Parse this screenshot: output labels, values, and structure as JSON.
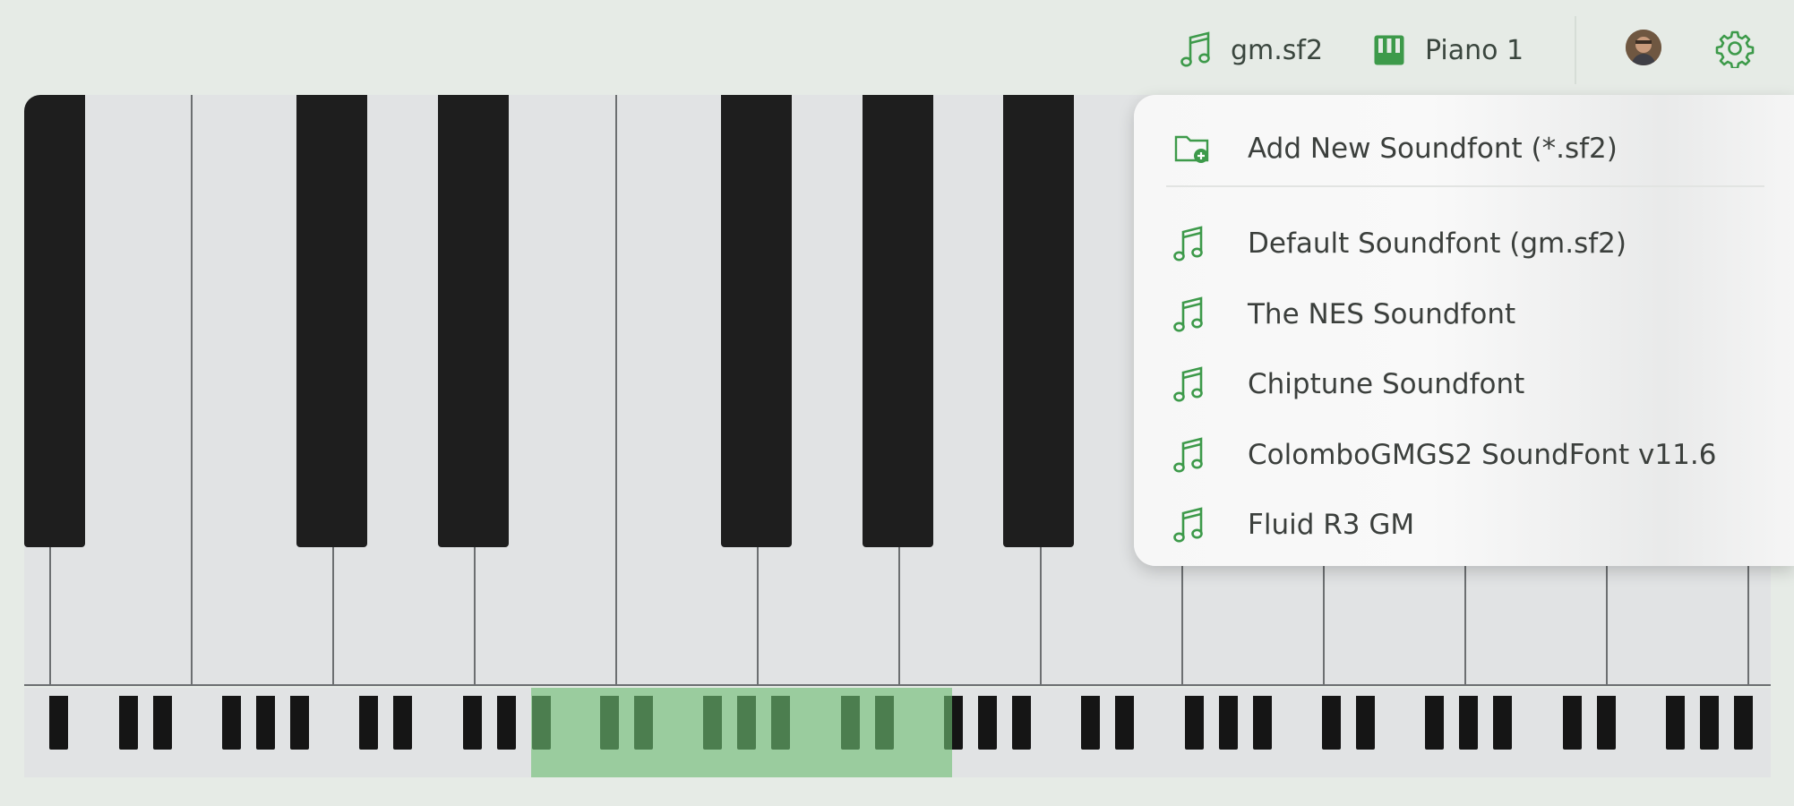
{
  "topbar": {
    "soundfont_label": "gm.sf2",
    "instrument_label": "Piano 1",
    "icons": {
      "soundfont": "music-note-icon",
      "instrument": "piano-keys-icon",
      "settings": "gear-icon"
    }
  },
  "dropdown": {
    "add_label": "Add New Soundfont (*.sf2)",
    "items": [
      "Default Soundfont (gm.sf2)",
      "The NES Soundfont",
      "Chiptune Soundfont",
      "ColomboGMGS2 SoundFont v11.6",
      "Fluid R3 GM"
    ]
  },
  "colors": {
    "accent": "#3d9a4a",
    "background": "#e6ebe6",
    "black_key": "#1e1e1e",
    "selection": "#8dc98e"
  }
}
